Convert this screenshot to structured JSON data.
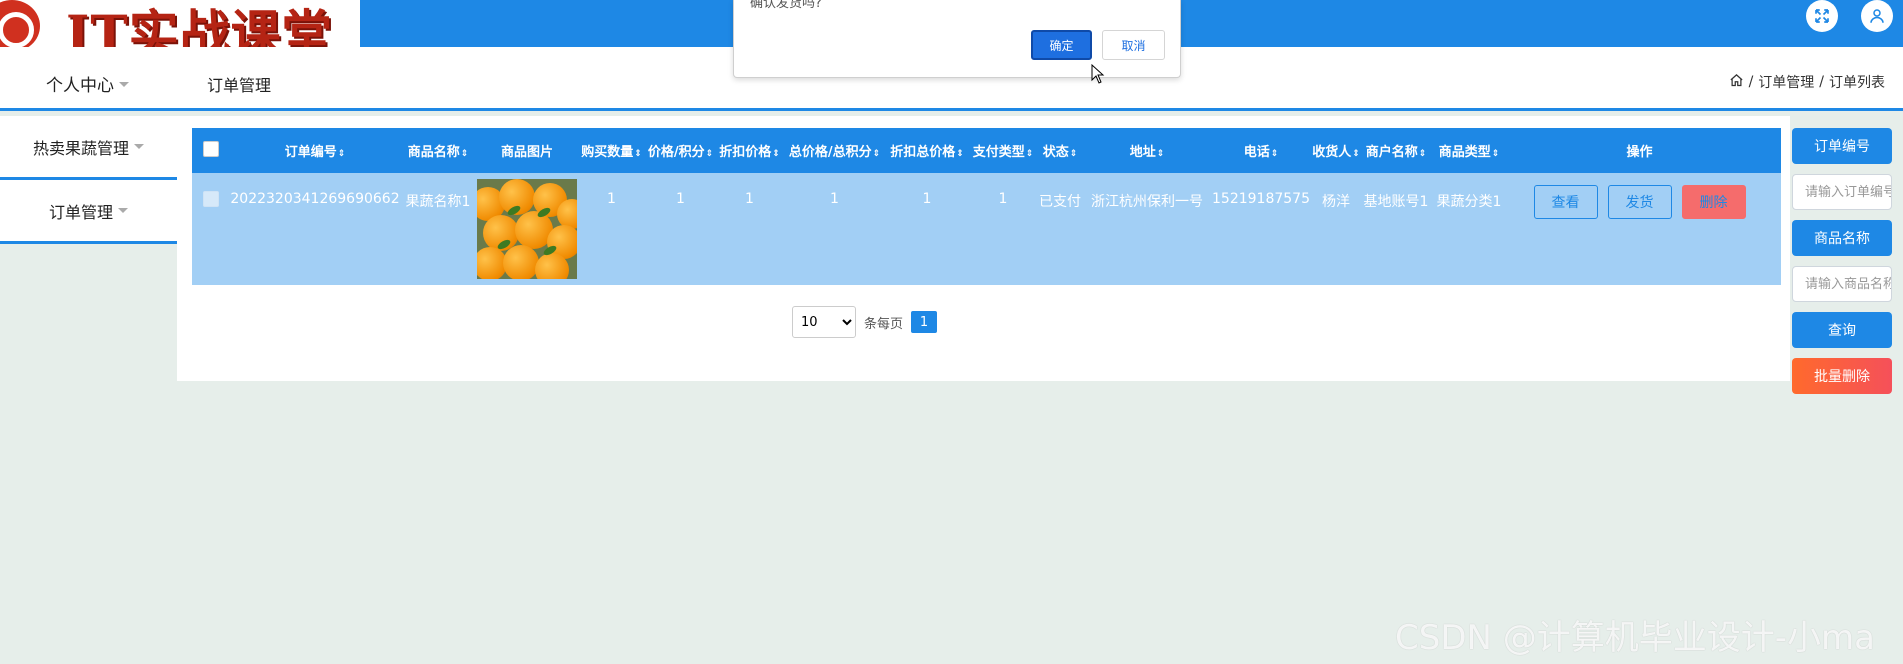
{
  "header": {
    "logo_text": "IT实战课堂",
    "fullscreen_icon": "expand-icon",
    "user_icon": "user-icon",
    "accent_color": "#1e88e5"
  },
  "nav": {
    "personal_center": "个人中心",
    "page_title": "订单管理",
    "breadcrumb": {
      "home_icon": "home-icon",
      "level1": "订单管理",
      "separator": "/",
      "level2": "订单列表"
    }
  },
  "sidebar": {
    "items": [
      {
        "label": "热卖果蔬管理"
      },
      {
        "label": "订单管理"
      }
    ]
  },
  "table": {
    "columns": [
      "订单编号",
      "商品名称",
      "商品图片",
      "购买数量",
      "价格/积分",
      "折扣价格",
      "总价格/总积分",
      "折扣总价格",
      "支付类型",
      "状态",
      "地址",
      "电话",
      "收货人",
      "商户名称",
      "商品类型",
      "操作"
    ],
    "sort_glyph": "⇕",
    "rows": [
      {
        "order_no": "2022320341269690662",
        "product_name": "果蔬名称1",
        "image_alt": "oranges",
        "quantity": "1",
        "price": "1",
        "discount_price": "1",
        "total_price": "1",
        "discount_total": "1",
        "pay_type": "1",
        "status": "已支付",
        "address": "浙江杭州保利一号",
        "phone": "15219187575",
        "receiver": "杨洋",
        "merchant": "基地账号1",
        "product_type": "果蔬分类1",
        "actions": {
          "view": "查看",
          "ship": "发货",
          "delete": "删除"
        }
      }
    ]
  },
  "pager": {
    "page_size": "10",
    "page_size_options": [
      "10"
    ],
    "per_page_label": "条每页",
    "current_page": "1"
  },
  "search_panel": {
    "order_no_label": "订单编号",
    "order_no_placeholder": "请输入订单编号",
    "product_name_label": "商品名称",
    "product_name_placeholder": "请输入商品名称",
    "search_button": "查询",
    "batch_delete_button": "批量删除"
  },
  "dialog": {
    "message": "确认发货吗?",
    "ok": "确定",
    "cancel": "取消"
  },
  "watermark": "CSDN @计算机毕业设计-小ma"
}
